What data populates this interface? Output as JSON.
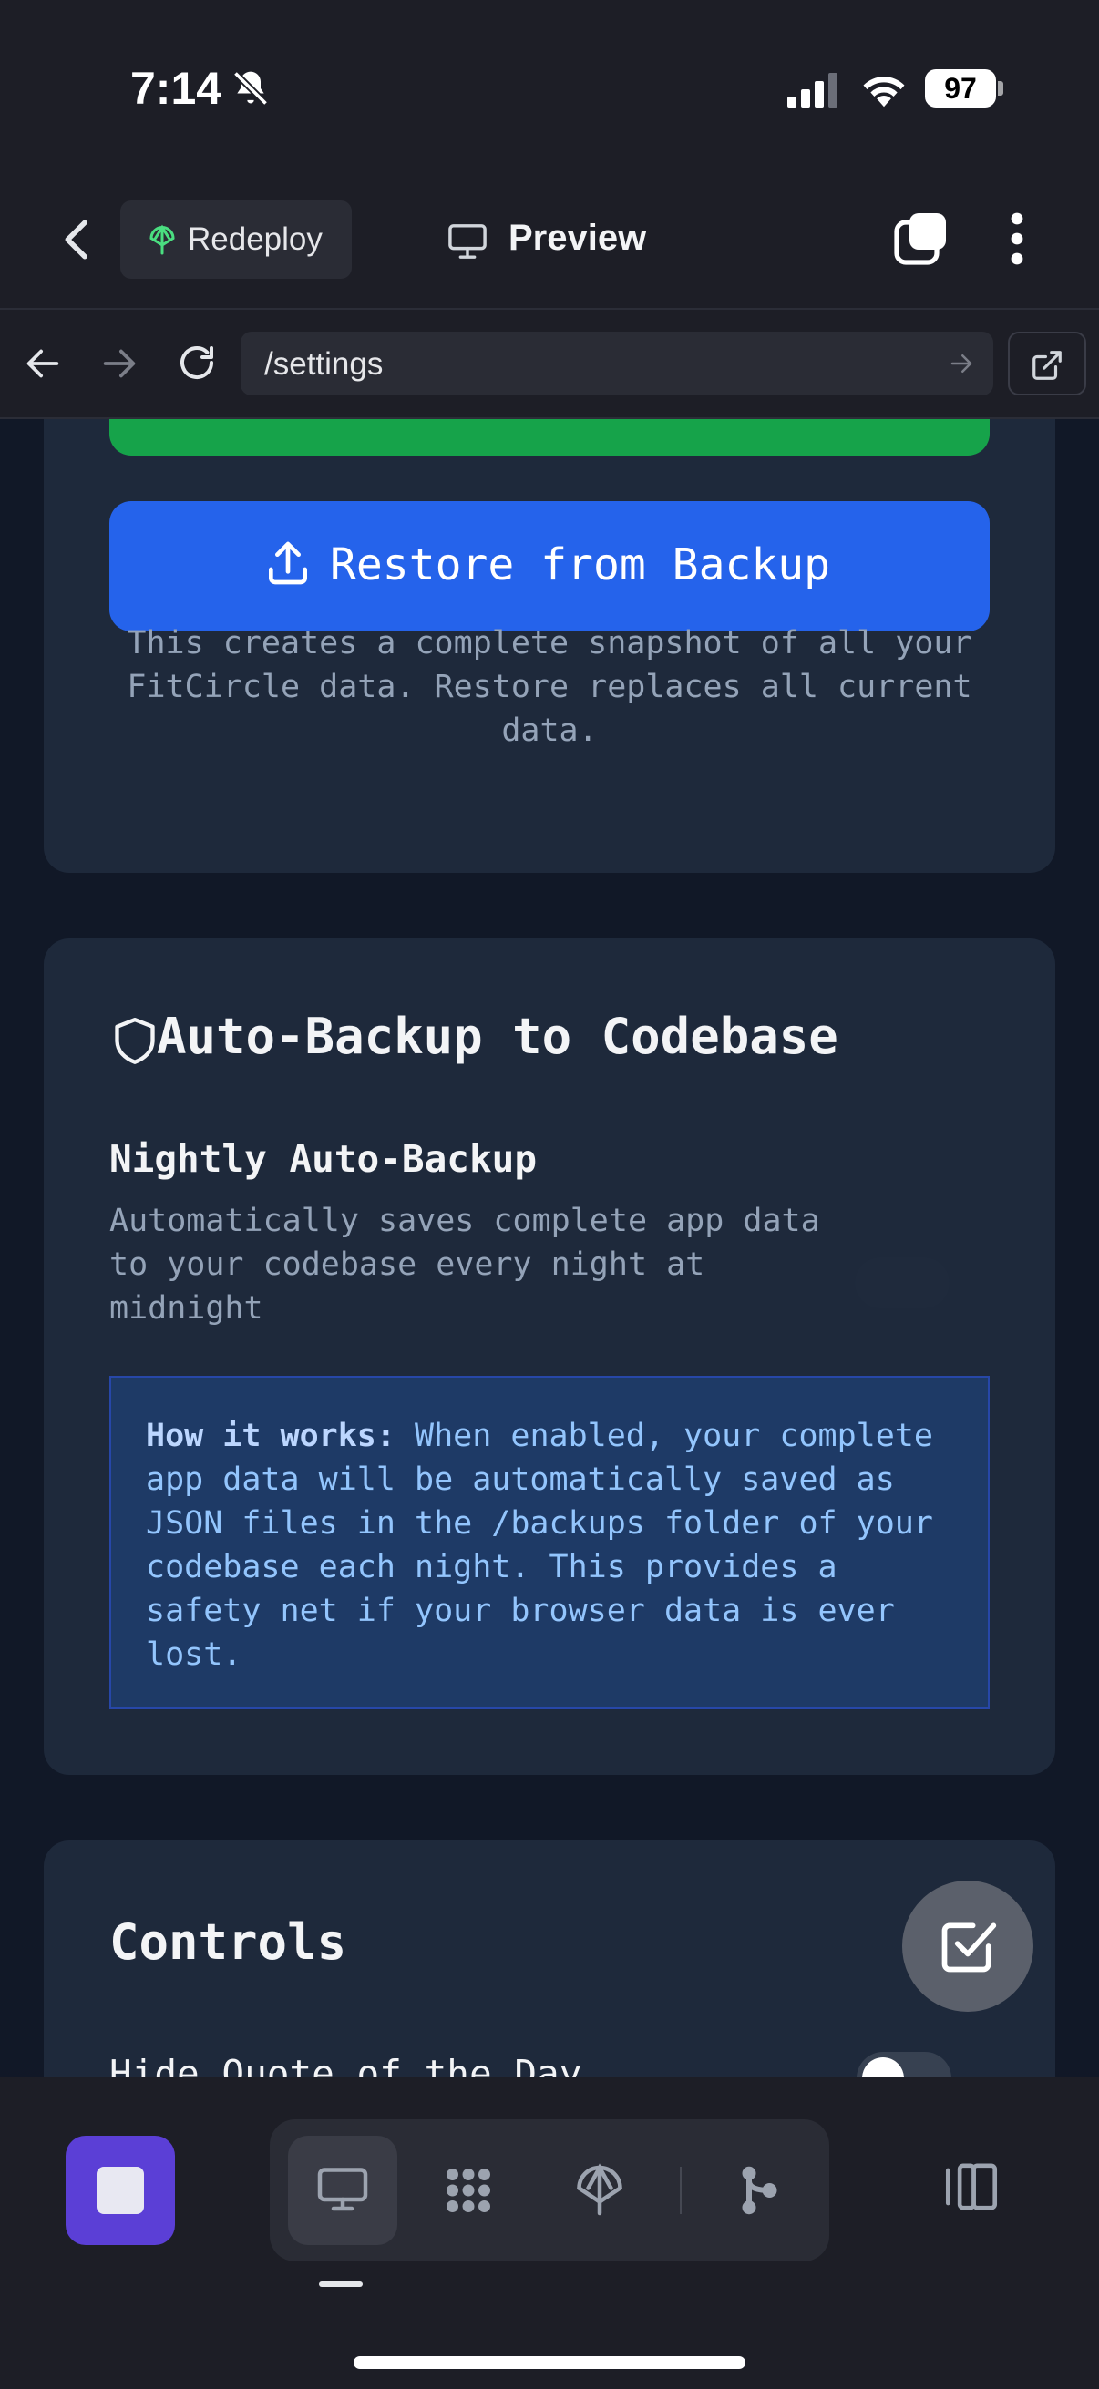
{
  "status_bar": {
    "time": "7:14",
    "battery": "97"
  },
  "header": {
    "redeploy_label": "Redeploy",
    "preview_label": "Preview"
  },
  "url_bar": {
    "path": "/settings"
  },
  "backup_card": {
    "restore_label": "Restore from Backup",
    "note": "This creates a complete snapshot of all your FitCircle data. Restore replaces all current data."
  },
  "auto_backup_card": {
    "title": "Auto-Backup to Codebase",
    "nightly_title": "Nightly Auto-Backup",
    "nightly_desc": "Automatically saves complete app data to your codebase every night at midnight",
    "info_bold": "How it works:",
    "info_text": " When enabled, your complete app data will be automatically saved as JSON files in the /backups folder of your codebase each night. This provides a safety net if your browser data is ever lost."
  },
  "controls_card": {
    "title": "Controls",
    "hide_quote_label": "Hide Quote of the Day"
  },
  "colors": {
    "accent_blue": "#2563eb",
    "accent_green": "#16a34a",
    "stop_purple": "#5b3fd6"
  },
  "icons": [
    "bell-slash-icon",
    "signal-icon",
    "wifi-icon",
    "chevron-left-icon",
    "redeploy-icon",
    "monitor-icon",
    "tabs-icon",
    "more-icon",
    "arrow-left-icon",
    "arrow-right-icon",
    "reload-icon",
    "external-link-icon",
    "upload-icon",
    "shield-icon",
    "checkbox-icon",
    "stop-icon",
    "workspace-icon",
    "deploy-icon",
    "git-icon",
    "split-view-icon"
  ]
}
